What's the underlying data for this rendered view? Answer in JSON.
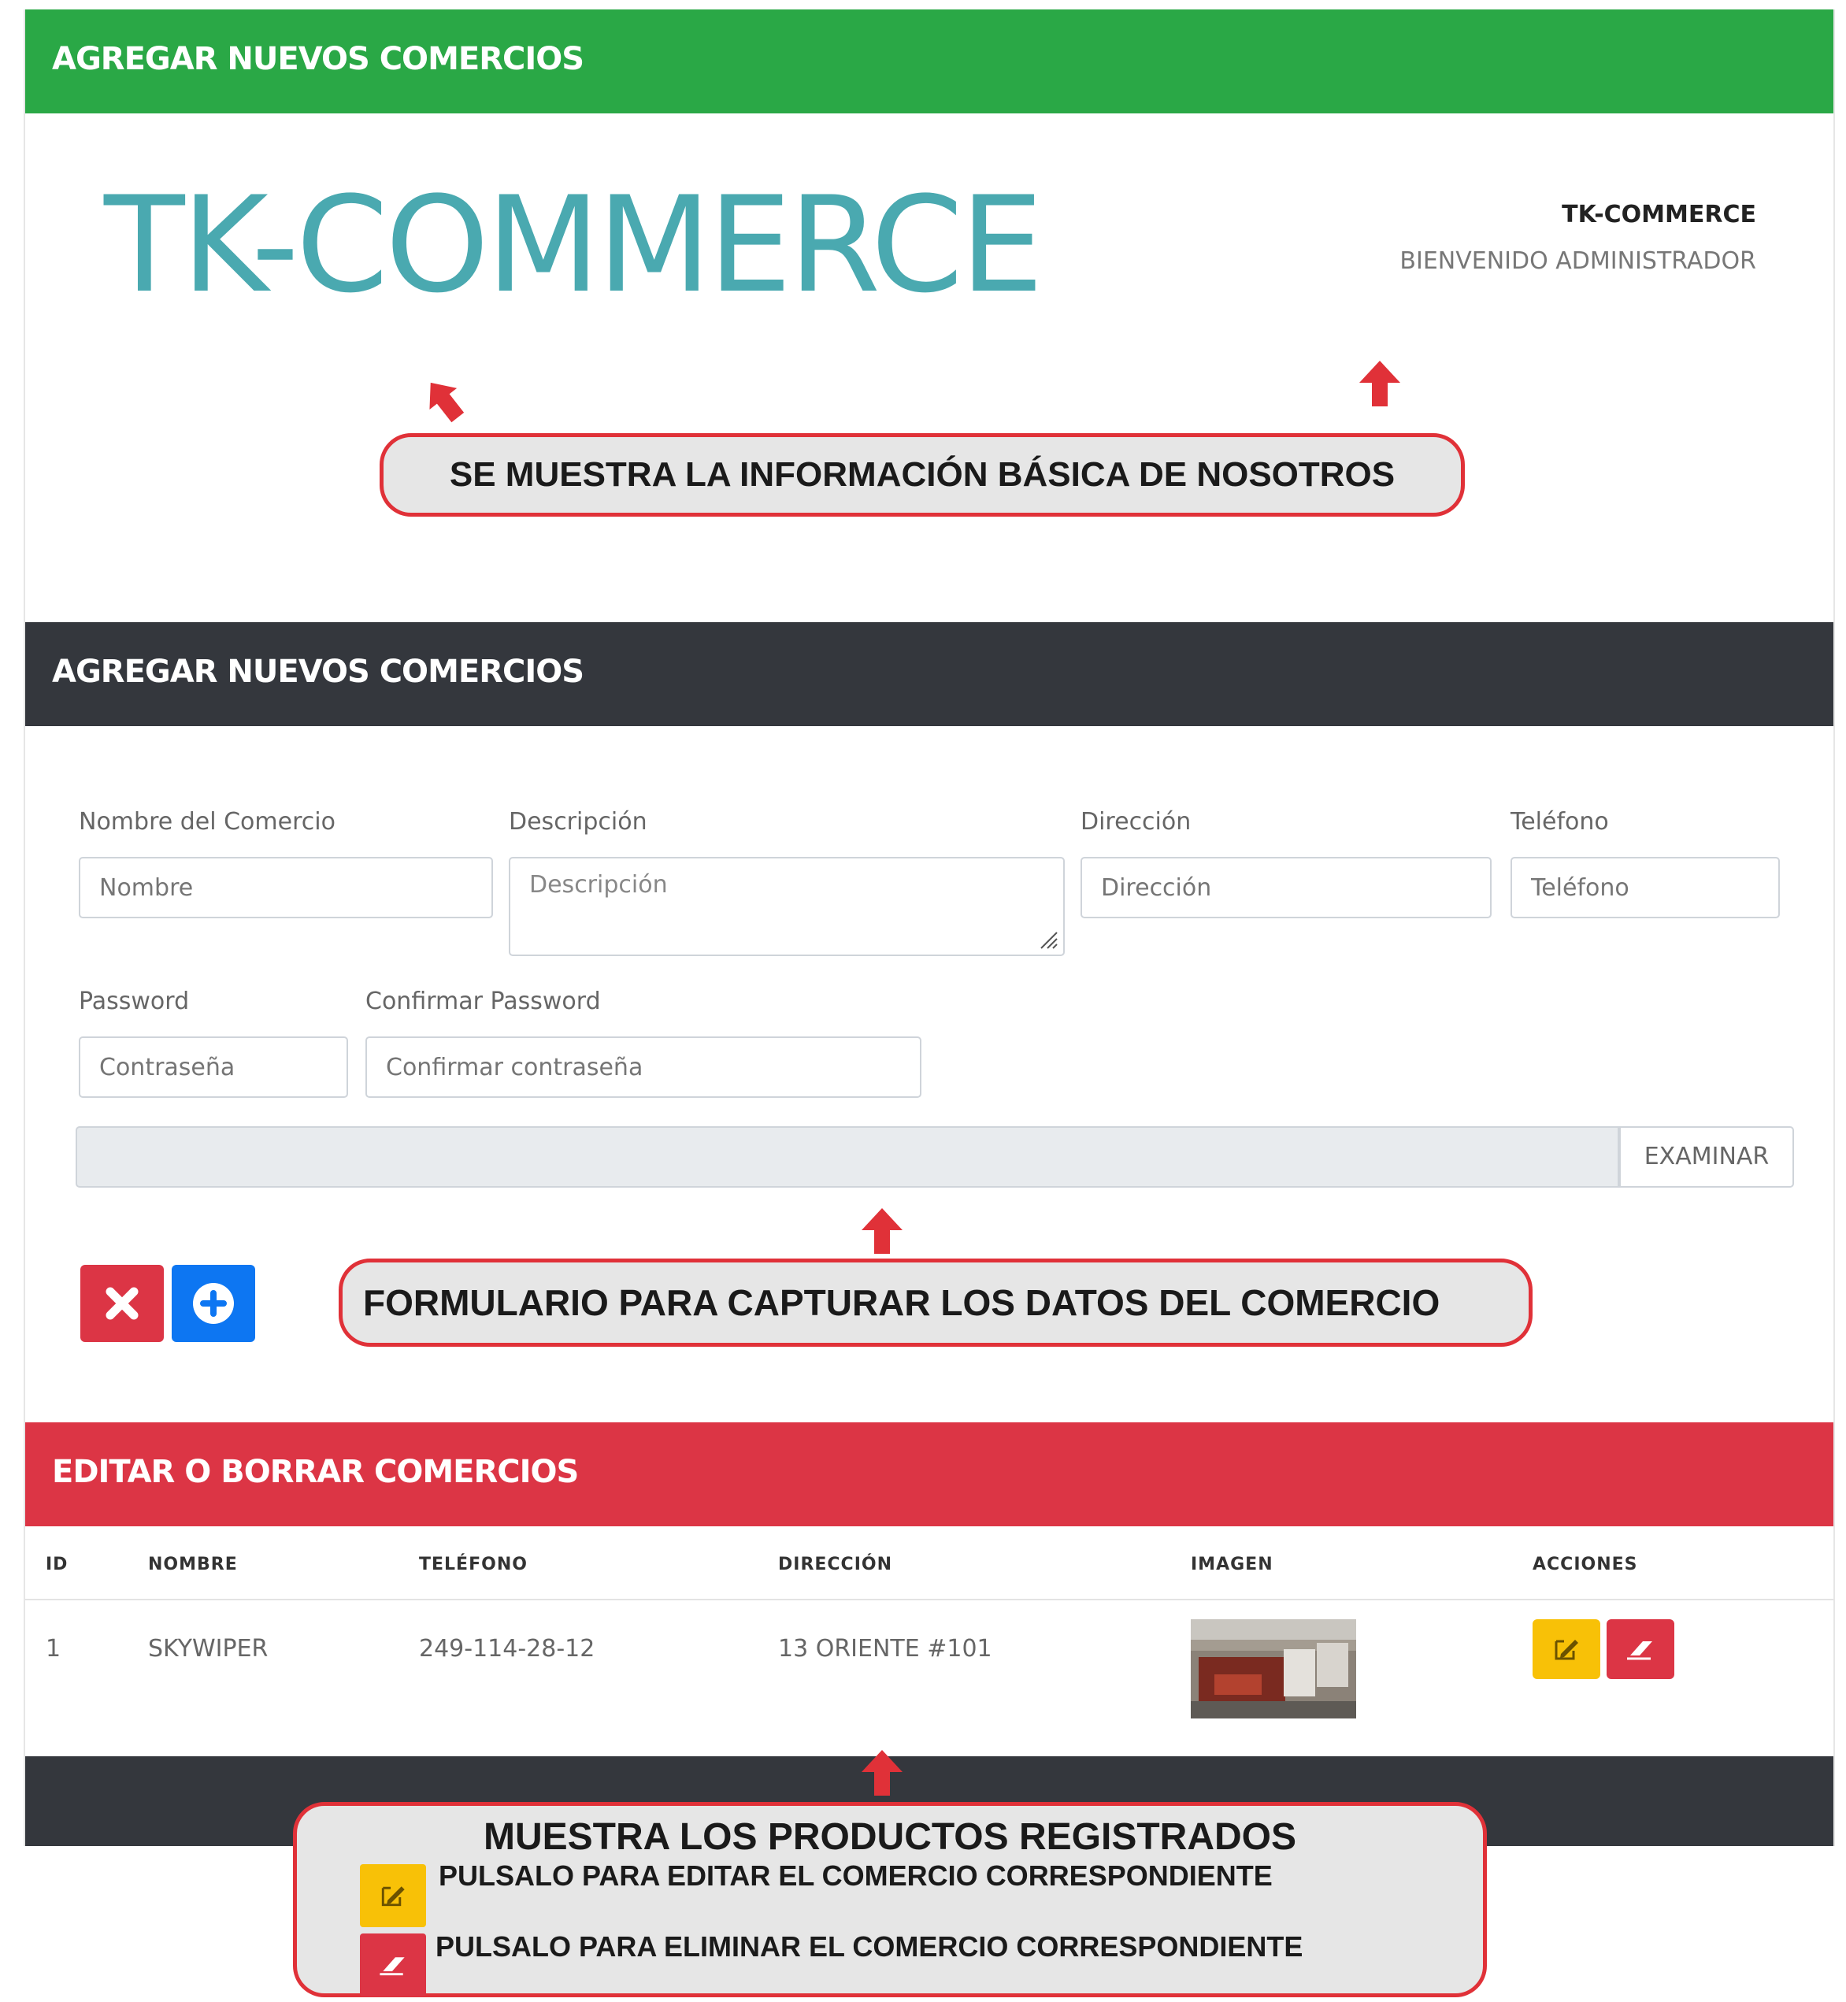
{
  "header": {
    "title": "AGREGAR NUEVOS COMERCIOS"
  },
  "brand": {
    "logo": "TK-COMMERCE",
    "name": "TK-COMMERCE",
    "welcome": "BIENVENIDO ADMINISTRADOR"
  },
  "form_section": {
    "title": "AGREGAR NUEVOS COMERCIOS",
    "nombre": {
      "label": "Nombre del Comercio",
      "placeholder": "Nombre"
    },
    "descripcion": {
      "label": "Descripción",
      "placeholder": "Descripción"
    },
    "direccion": {
      "label": "Dirección",
      "placeholder": "Dirección"
    },
    "telefono": {
      "label": "Teléfono",
      "placeholder": "Teléfono"
    },
    "password": {
      "label": "Password",
      "placeholder": "Contraseña"
    },
    "confirm": {
      "label": "Confirmar Password",
      "placeholder": "Confirmar contraseña"
    },
    "file_button": "EXAMINAR"
  },
  "table_section": {
    "title": "EDITAR O BORRAR COMERCIOS",
    "headers": [
      "ID",
      "NOMBRE",
      "TELÉFONO",
      "DIRECCIÓN",
      "IMAGEN",
      "ACCIONES"
    ],
    "rows": [
      {
        "id": "1",
        "nombre": "SKYWIPER",
        "telefono": "249-114-28-12",
        "direccion": "13 ORIENTE #101"
      }
    ]
  },
  "callouts": {
    "info": "SE MUESTRA LA INFORMACIÓN BÁSICA DE NOSOTROS",
    "form": "FORMULARIO PARA CAPTURAR LOS DATOS DEL COMERCIO",
    "list_title": "MUESTRA LOS PRODUCTOS REGISTRADOS",
    "edit_hint": "PULSALO PARA EDITAR EL COMERCIO CORRESPONDIENTE",
    "delete_hint": "PULSALO PARA ELIMINAR EL COMERCIO CORRESPONDIENTE"
  },
  "colors": {
    "green_bar": "#2aa846",
    "dark_bar": "#34373d",
    "red_bar": "#dc3545",
    "logo": "#4aa9b0",
    "add_button": "#0d76f2",
    "edit_button": "#f8c107",
    "callout_border": "#e03138"
  },
  "icons": [
    "close-icon",
    "plus-circle-icon",
    "edit-icon",
    "eraser-icon",
    "arrow-up-icon"
  ]
}
